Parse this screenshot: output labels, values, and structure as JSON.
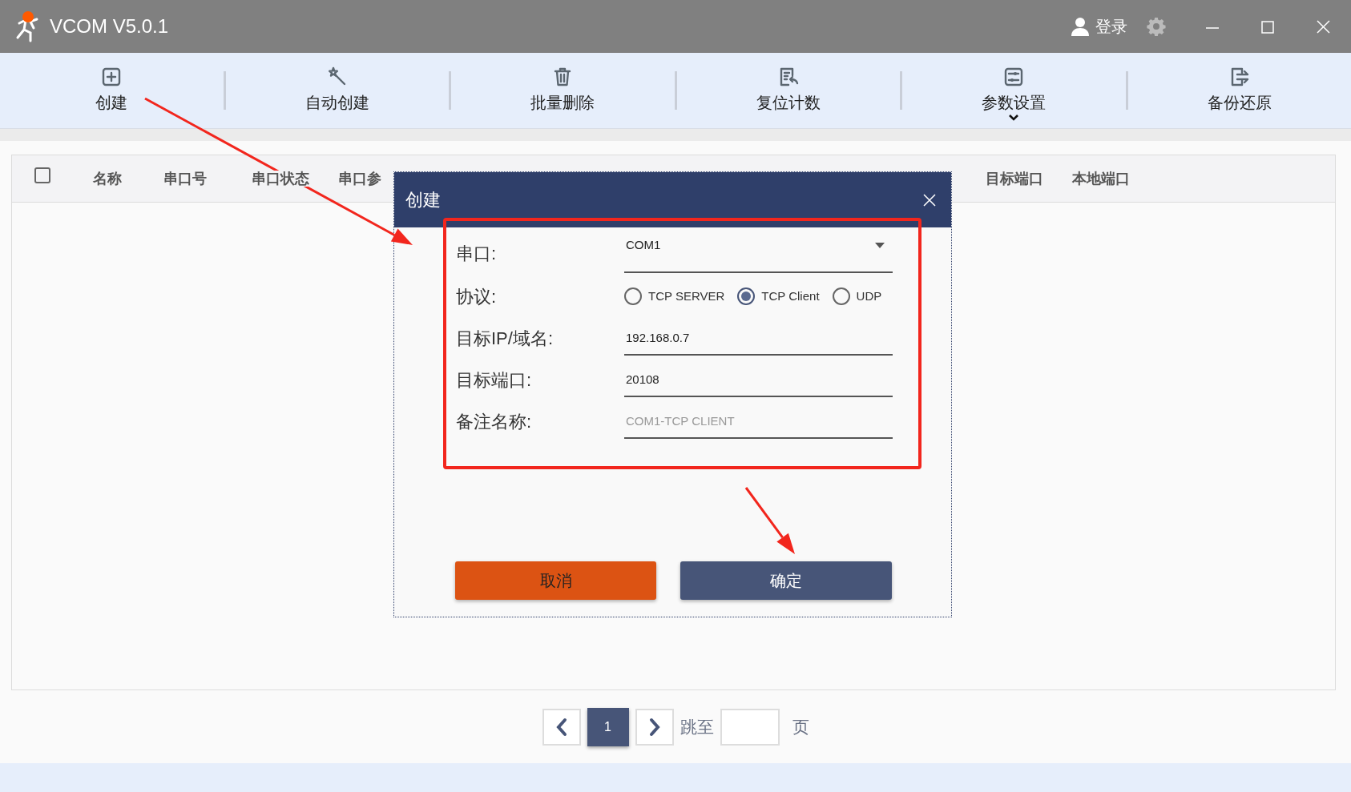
{
  "window": {
    "title": "VCOM V5.0.1",
    "login": "登录"
  },
  "toolbar": [
    {
      "label": "创建",
      "kind": "button"
    },
    {
      "label": "自动创建",
      "kind": "button"
    },
    {
      "label": "批量删除",
      "kind": "button"
    },
    {
      "label": "复位计数",
      "kind": "button"
    },
    {
      "label": "参数设置",
      "kind": "dropdown"
    },
    {
      "label": "备份还原",
      "kind": "button"
    }
  ],
  "table": {
    "select_all": {
      "checked": false
    },
    "columns_left": [
      "名称",
      "串口号",
      "串口状态",
      "串口参"
    ],
    "columns_right": [
      "目标端口",
      "本地端口"
    ]
  },
  "pagination": {
    "pages": [
      {
        "label": "1",
        "selected": true
      }
    ],
    "jump_label": "跳至",
    "page_suffix": "页"
  },
  "dialog": {
    "title": "创建",
    "fields": [
      {
        "label": "串口:",
        "kind": "select",
        "value": "COM1"
      },
      {
        "label": "协议:",
        "kind": "radio",
        "options": [
          {
            "label": "TCP SERVER",
            "selected": false
          },
          {
            "label": "TCP Client",
            "selected": true
          },
          {
            "label": "UDP",
            "selected": false
          }
        ]
      },
      {
        "label": "目标IP/域名:",
        "kind": "text",
        "value": "192.168.0.7"
      },
      {
        "label": "目标端口:",
        "kind": "text",
        "value": "20108"
      },
      {
        "label": "备注名称:",
        "kind": "text",
        "placeholder": "COM1-TCP CLIENT"
      }
    ],
    "buttons": [
      {
        "label": "取消",
        "kind": "cancel"
      },
      {
        "label": "确定",
        "kind": "confirm"
      }
    ]
  }
}
